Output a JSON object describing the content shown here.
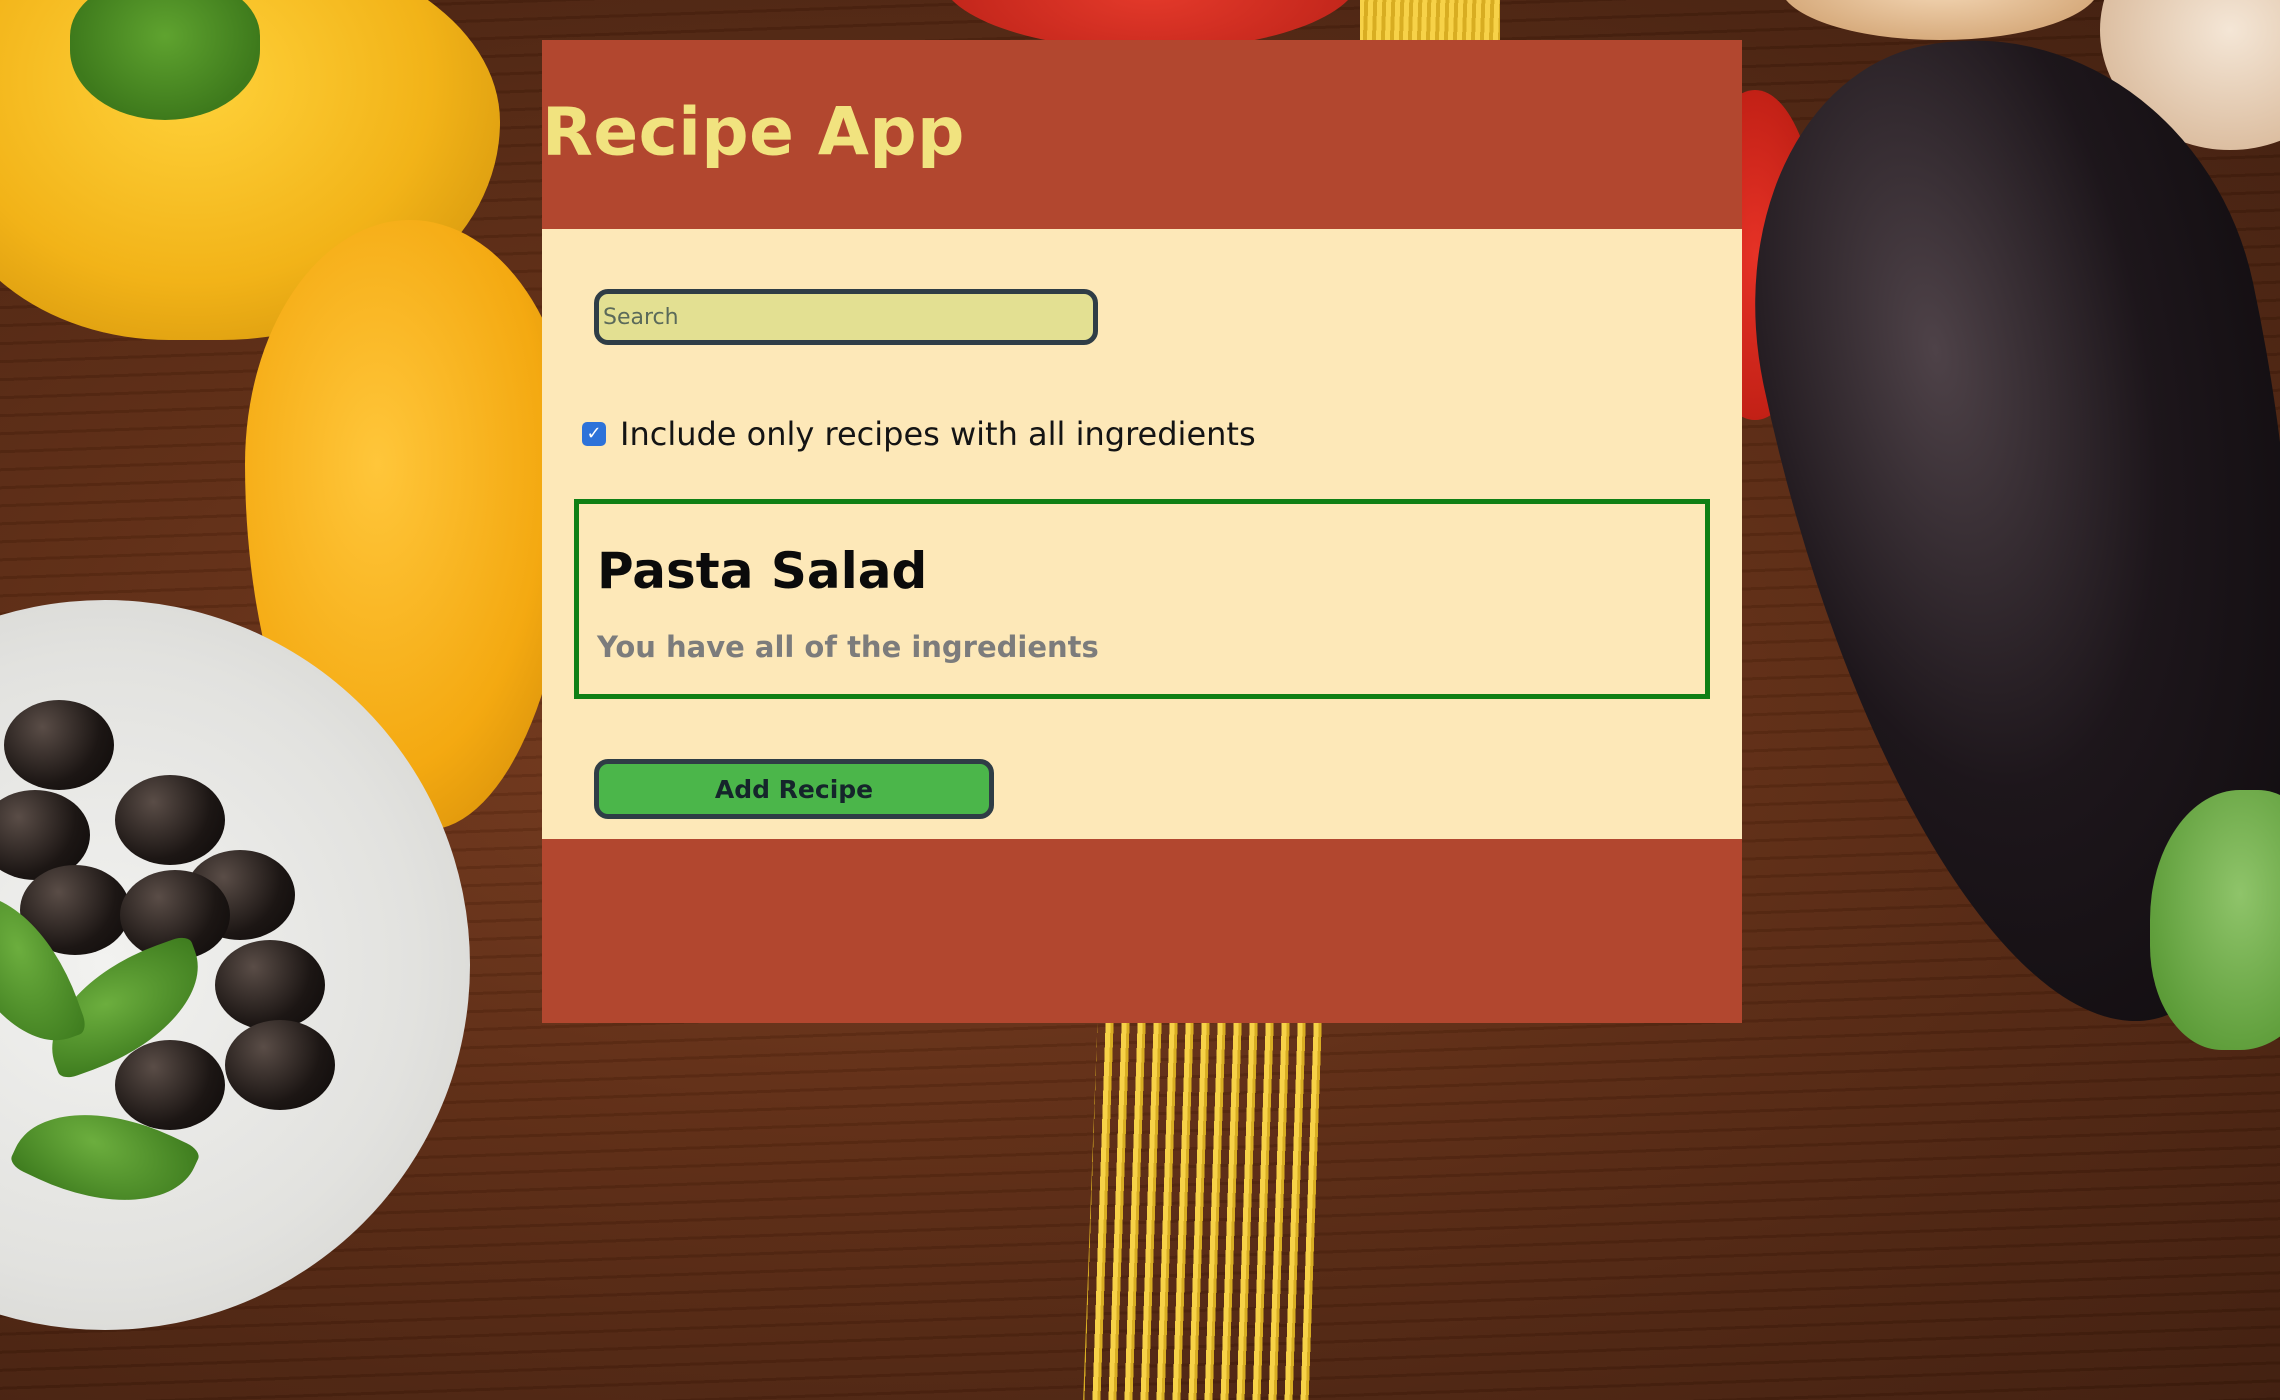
{
  "header": {
    "title": "Recipe App"
  },
  "search": {
    "placeholder": "Search",
    "value": ""
  },
  "filter": {
    "label": "Include only recipes with all ingredients",
    "checked": true
  },
  "recipes": [
    {
      "title": "Pasta Salad",
      "status": "You have all of the ingredients"
    }
  ],
  "actions": {
    "add_recipe_label": "Add Recipe"
  },
  "colors": {
    "header_bg": "#b2472f",
    "title": "#f1e37f",
    "content_bg": "#fde8b8",
    "search_bg": "#e3e092",
    "card_border": "#0f7f14",
    "button_bg": "#4bb64a",
    "checkbox": "#2d72d9"
  },
  "icons": {
    "checkbox_check": "check-icon"
  }
}
